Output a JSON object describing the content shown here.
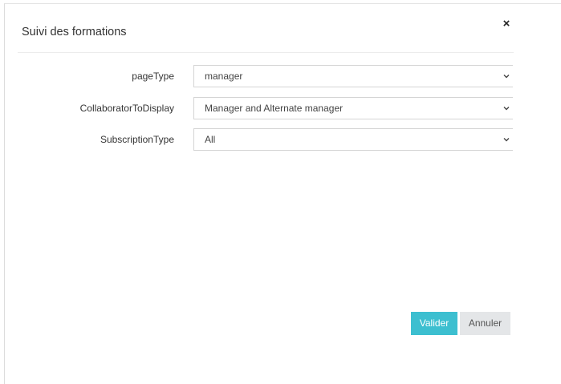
{
  "dialog": {
    "title": "Suivi des formations",
    "close_glyph": "×",
    "close_icon": "close-icon"
  },
  "form": {
    "fields": [
      {
        "label": "pageType",
        "value": "manager",
        "icon": "chevron-down-icon"
      },
      {
        "label": "CollaboratorToDisplay",
        "value": "Manager and Alternate manager",
        "icon": "chevron-down-icon"
      },
      {
        "label": "SubscriptionType",
        "value": "All",
        "icon": "chevron-down-icon"
      }
    ]
  },
  "actions": {
    "validate_label": "Valider",
    "cancel_label": "Annuler"
  },
  "colors": {
    "primary": "#3dbfd0",
    "secondary": "#e4e6e8",
    "border": "#d4d4d4"
  }
}
